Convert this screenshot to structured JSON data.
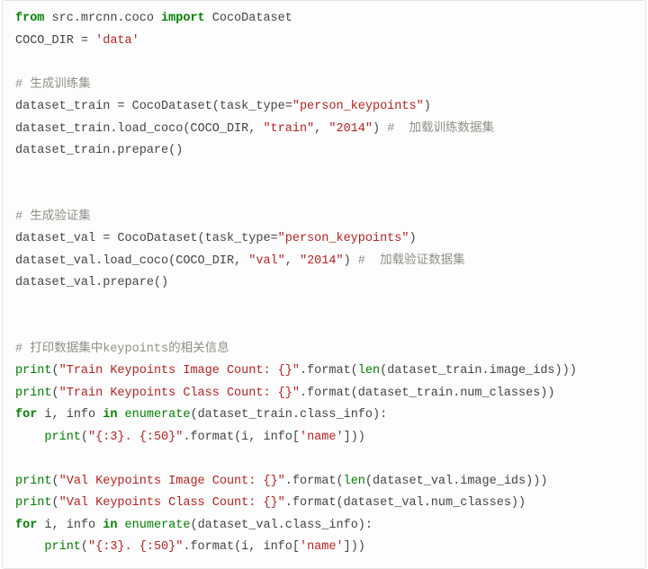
{
  "code": {
    "l0": {
      "kw1": "from",
      "mod": " src.mrcnn.coco ",
      "kw2": "import",
      "cls": " CocoDataset"
    },
    "l1": {
      "lhs": "COCO_DIR = ",
      "str": "'data'"
    },
    "l2": "",
    "l3": {
      "cmt": "# 生成训练集"
    },
    "l4": {
      "a": "dataset_train = CocoDataset(task_type=",
      "str": "\"person_keypoints\"",
      "b": ")"
    },
    "l5": {
      "a": "dataset_train.load_coco(COCO_DIR, ",
      "s1": "\"train\"",
      "c": ", ",
      "s2": "\"2014\"",
      "d": ") ",
      "cmt": "#  加载训练数据集"
    },
    "l6": "dataset_train.prepare()",
    "l7": "",
    "l8": "",
    "l9": {
      "cmt": "# 生成验证集"
    },
    "l10": {
      "a": "dataset_val = CocoDataset(task_type=",
      "str": "\"person_keypoints\"",
      "b": ")"
    },
    "l11": {
      "a": "dataset_val.load_coco(COCO_DIR, ",
      "s1": "\"val\"",
      "c": ", ",
      "s2": "\"2014\"",
      "d": ") ",
      "cmt": "#  加载验证数据集"
    },
    "l12": "dataset_val.prepare()",
    "l13": "",
    "l14": "",
    "l15": {
      "cmt": "# 打印数据集中keypoints的相关信息"
    },
    "l16": {
      "p": "print",
      "a": "(",
      "s": "\"Train Keypoints Image Count: {}\"",
      "b": ".format(",
      "fn": "len",
      "c": "(dataset_train.image_ids)))"
    },
    "l17": {
      "p": "print",
      "a": "(",
      "s": "\"Train Keypoints Class Count: {}\"",
      "b": ".format(dataset_train.num_classes))"
    },
    "l18": {
      "kw1": "for",
      "a": " i, info ",
      "kw2": "in",
      "b": " ",
      "fn": "enumerate",
      "c": "(dataset_train.class_info):"
    },
    "l19": {
      "sp": "    ",
      "p": "print",
      "a": "(",
      "s": "\"{:3}. {:50}\"",
      "b": ".format(i, info[",
      "s2": "'name'",
      "c": "]))"
    },
    "l20": "",
    "l21": {
      "p": "print",
      "a": "(",
      "s": "\"Val Keypoints Image Count: {}\"",
      "b": ".format(",
      "fn": "len",
      "c": "(dataset_val.image_ids)))"
    },
    "l22": {
      "p": "print",
      "a": "(",
      "s": "\"Val Keypoints Class Count: {}\"",
      "b": ".format(dataset_val.num_classes))"
    },
    "l23": {
      "kw1": "for",
      "a": " i, info ",
      "kw2": "in",
      "b": " ",
      "fn": "enumerate",
      "c": "(dataset_val.class_info):"
    },
    "l24": {
      "sp": "    ",
      "p": "print",
      "a": "(",
      "s": "\"{:3}. {:50}\"",
      "b": ".format(i, info[",
      "s2": "'name'",
      "c": "]))"
    }
  }
}
